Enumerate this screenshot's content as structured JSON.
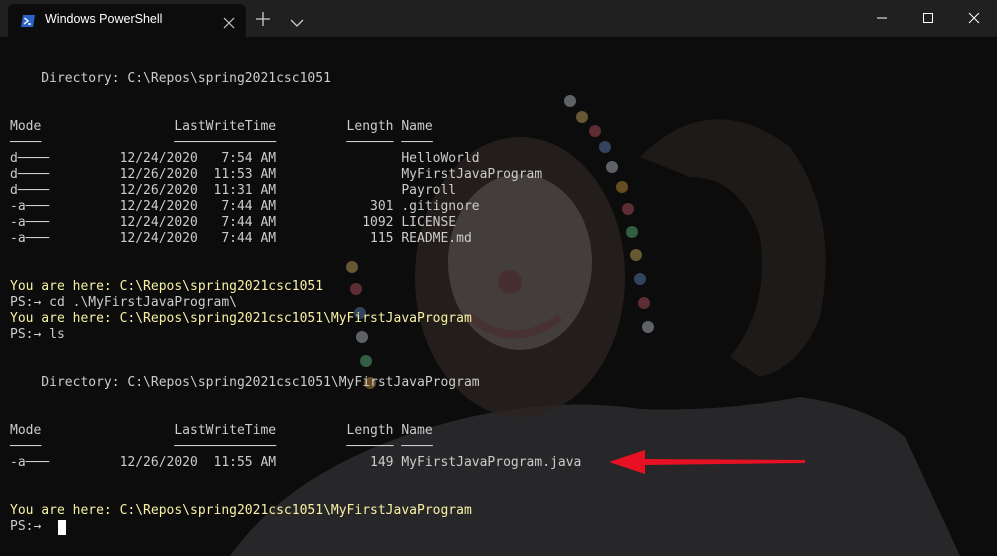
{
  "window": {
    "tab_title": "Windows PowerShell",
    "tab_icon": "powershell-icon",
    "new_tab_icon": "plus-icon",
    "dropdown_icon": "chevron-down-icon",
    "controls": [
      "minimize-icon",
      "maximize-icon",
      "close-icon"
    ]
  },
  "colors": {
    "titlebar": "#202020",
    "terminal_bg": "#0c0c0c",
    "text": "#cccccc",
    "prompt_text": "#f9f1a5",
    "arrow": "#e81123"
  },
  "terminal": {
    "lines": [
      "    Directory: C:\\Repos\\spring2021csc1051",
      "Mode                 LastWriteTime         Length Name",
      "────                 ─────────────         ────── ────",
      "d────         12/24/2020   7:54 AM                HelloWorld",
      "d────         12/26/2020  11:53 AM                MyFirstJavaProgram",
      "d────         12/26/2020  11:31 AM                Payroll",
      "-a───         12/24/2020   7:44 AM            301 .gitignore",
      "-a───         12/24/2020   7:44 AM           1092 LICENSE",
      "-a───         12/24/2020   7:44 AM            115 README.md",
      "You are here: C:\\Repos\\spring2021csc1051",
      "PS:→ cd .\\MyFirstJavaProgram\\",
      "You are here: C:\\Repos\\spring2021csc1051\\MyFirstJavaProgram",
      "PS:→ ls",
      "    Directory: C:\\Repos\\spring2021csc1051\\MyFirstJavaProgram",
      "Mode                 LastWriteTime         Length Name",
      "────                 ─────────────         ────── ────",
      "-a───         12/26/2020  11:55 AM            149 MyFirstJavaProgram.java",
      "You are here: C:\\Repos\\spring2021csc1051\\MyFirstJavaProgram",
      "PS:→ "
    ]
  }
}
